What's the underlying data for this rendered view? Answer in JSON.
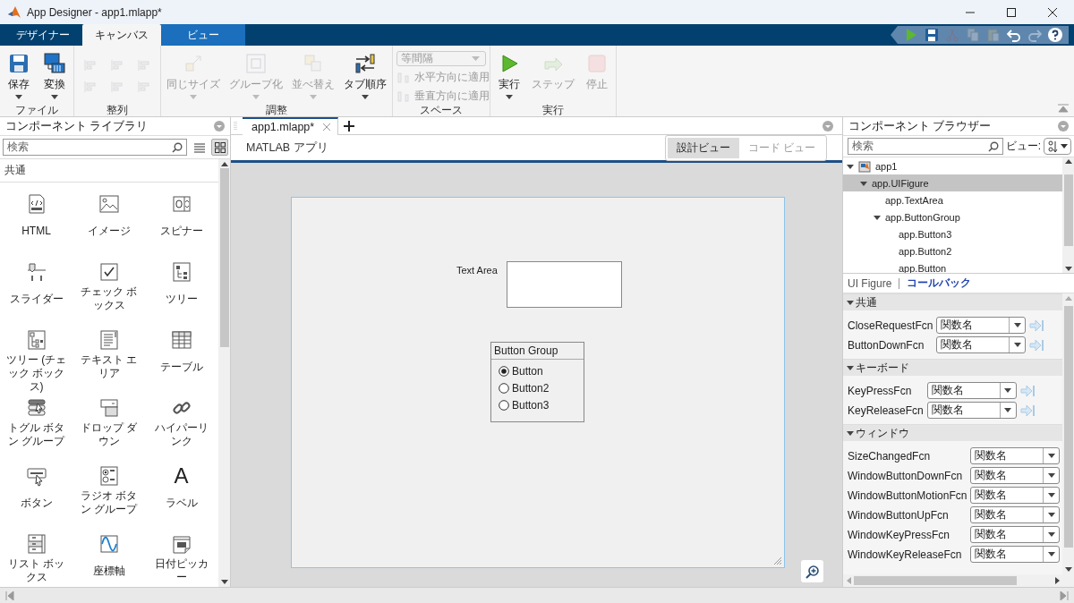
{
  "window": {
    "title": "App Designer - app1.mlapp*"
  },
  "ribbon_tabs": [
    {
      "label": "デザイナー",
      "selected": false,
      "hovered": false
    },
    {
      "label": "キャンバス",
      "selected": true,
      "hovered": false
    },
    {
      "label": "ビュー",
      "selected": false,
      "hovered": true
    }
  ],
  "quick_access": [
    {
      "kind": "run",
      "disabled": false
    },
    {
      "kind": "save",
      "disabled": false
    },
    {
      "kind": "cut",
      "disabled": true
    },
    {
      "kind": "copy",
      "disabled": true
    },
    {
      "kind": "paste",
      "disabled": true
    },
    {
      "kind": "undo",
      "disabled": false
    },
    {
      "kind": "redo",
      "disabled": true
    },
    {
      "kind": "help",
      "disabled": false
    }
  ],
  "ribbon_groups": [
    {
      "label": "ファイル",
      "items": [
        {
          "kind": "save",
          "label": "保存",
          "disabled": false,
          "menu": true
        },
        {
          "kind": "convert",
          "label": "変換",
          "disabled": false,
          "menu": true
        }
      ]
    },
    {
      "label": "整列",
      "items": [
        {
          "kind": "align",
          "disabled": true
        },
        {
          "kind": "align",
          "disabled": true
        },
        {
          "kind": "align",
          "disabled": true
        },
        {
          "kind": "align",
          "disabled": true
        },
        {
          "kind": "align",
          "disabled": true
        },
        {
          "kind": "align",
          "disabled": true
        }
      ]
    },
    {
      "label": "調整",
      "items": [
        {
          "kind": "same-size",
          "label": "同じサイズ",
          "disabled": true,
          "menu": true
        },
        {
          "kind": "group",
          "label": "グループ化",
          "disabled": true,
          "menu": true
        },
        {
          "kind": "arrange",
          "label": "並べ替え",
          "disabled": true,
          "menu": true
        },
        {
          "kind": "tab-order",
          "label": "タブ順序",
          "disabled": false,
          "menu": true
        }
      ]
    },
    {
      "label": "スペース",
      "items": [
        {
          "kind": "dropdown",
          "label": "等間隔",
          "disabled": true
        },
        {
          "kind": "apply",
          "label": "水平方向に適用",
          "disabled": true
        },
        {
          "kind": "apply",
          "label": "垂直方向に適用",
          "disabled": true
        }
      ]
    },
    {
      "label": "実行",
      "items": [
        {
          "kind": "run",
          "label": "実行",
          "disabled": false,
          "menu": true
        },
        {
          "kind": "step",
          "label": "ステップ",
          "disabled": true,
          "menu": false
        },
        {
          "kind": "stop",
          "label": "停止",
          "disabled": true,
          "menu": false
        }
      ]
    }
  ],
  "library": {
    "title": "コンポーネント ライブラリ",
    "search": {
      "placeholder": "検索"
    },
    "view_modes": [
      {
        "kind": "list",
        "selected": false
      },
      {
        "kind": "grid",
        "selected": true
      }
    ],
    "section": "共通",
    "items": [
      {
        "kind": "html",
        "label": "HTML"
      },
      {
        "kind": "image",
        "label": "イメージ"
      },
      {
        "kind": "spinner",
        "label": "スピナー"
      },
      {
        "kind": "slider",
        "label": "スライダー"
      },
      {
        "kind": "checkbox",
        "label": "チェック ボックス"
      },
      {
        "kind": "tree",
        "label": "ツリー"
      },
      {
        "kind": "checktree",
        "label": "ツリー (チェック ボックス)"
      },
      {
        "kind": "textarea",
        "label": "テキスト エリア"
      },
      {
        "kind": "table",
        "label": "テーブル"
      },
      {
        "kind": "togglegroup",
        "label": "トグル ボタン グループ"
      },
      {
        "kind": "dropdown",
        "label": "ドロップ ダウン"
      },
      {
        "kind": "hyperlink",
        "label": "ハイパーリンク"
      },
      {
        "kind": "button",
        "label": "ボタン"
      },
      {
        "kind": "radiogroup",
        "label": "ラジオ ボタン グループ"
      },
      {
        "kind": "label",
        "label": "ラベル",
        "glyph": "A"
      },
      {
        "kind": "listbox",
        "label": "リスト ボックス"
      },
      {
        "kind": "axes",
        "label": "座標軸"
      },
      {
        "kind": "datepicker",
        "label": "日付ピッカー"
      }
    ]
  },
  "editor": {
    "tabs": [
      {
        "label": "app1.mlapp*",
        "selected": true
      }
    ],
    "header": "MATLAB アプリ",
    "views": [
      {
        "label": "設計ビュー",
        "selected": true
      },
      {
        "label": "コード ビュー",
        "selected": false
      }
    ],
    "figure": {
      "text_area": {
        "label": "Text Area"
      },
      "button_group": {
        "title": "Button Group",
        "buttons": [
          {
            "label": "Button",
            "selected": true
          },
          {
            "label": "Button2",
            "selected": false
          },
          {
            "label": "Button3",
            "selected": false
          }
        ]
      }
    }
  },
  "browser": {
    "title": "コンポーネント ブラウザー",
    "search": {
      "placeholder": "検索"
    },
    "view_label": "ビュー:",
    "tree": [
      {
        "label": "app1",
        "expanded": true,
        "selected": false,
        "children": [
          {
            "label": "app.UIFigure",
            "expanded": true,
            "selected": true,
            "children": [
              {
                "label": "app.TextArea",
                "selected": false
              },
              {
                "label": "app.ButtonGroup",
                "expanded": true,
                "selected": false,
                "children": [
                  {
                    "label": "app.Button3",
                    "selected": false
                  },
                  {
                    "label": "app.Button2",
                    "selected": false
                  },
                  {
                    "label": "app.Button",
                    "selected": false
                  }
                ]
              }
            ]
          }
        ]
      }
    ],
    "inspector_tabs": [
      {
        "label": "UI Figure",
        "selected": false
      },
      {
        "label": "コールバック",
        "selected": true
      }
    ],
    "sections": [
      {
        "title": "共通",
        "expanded": true,
        "rows": [
          {
            "name": "CloseRequestFcn",
            "value": "関数名"
          },
          {
            "name": "ButtonDownFcn",
            "value": "関数名"
          }
        ]
      },
      {
        "title": "キーボード",
        "expanded": true,
        "rows": [
          {
            "name": "KeyPressFcn",
            "value": "関数名"
          },
          {
            "name": "KeyReleaseFcn",
            "value": "関数名"
          }
        ]
      },
      {
        "title": "ウィンドウ",
        "expanded": true,
        "rows": [
          {
            "name": "SizeChangedFcn",
            "value": "関数名"
          },
          {
            "name": "WindowButtonDownFcn",
            "value": "関数名"
          },
          {
            "name": "WindowButtonMotionFcn",
            "value": "関数名"
          },
          {
            "name": "WindowButtonUpFcn",
            "value": "関数名"
          },
          {
            "name": "WindowKeyPressFcn",
            "value": "関数名"
          },
          {
            "name": "WindowKeyReleaseFcn",
            "value": "関数名"
          }
        ]
      }
    ]
  }
}
